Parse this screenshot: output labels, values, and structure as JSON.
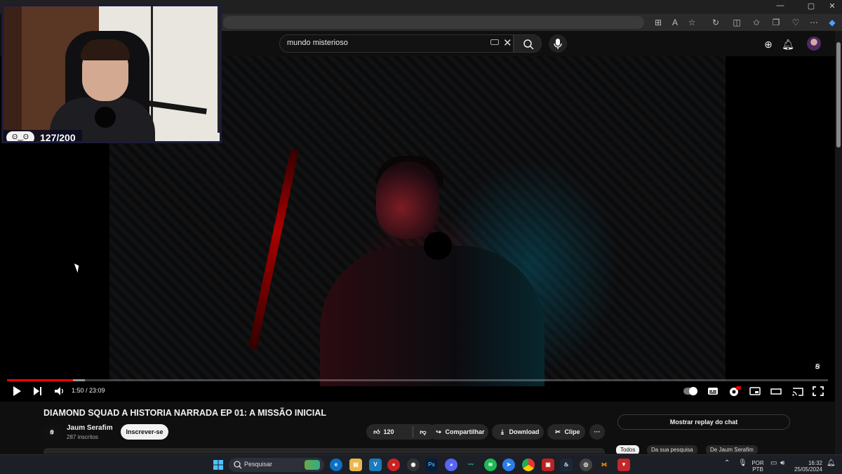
{
  "window": {
    "controls": [
      "—",
      "▢",
      "✕"
    ]
  },
  "browser_toolbar": {
    "icons": [
      "grid-icon",
      "read-aloud-icon",
      "favorite-star-icon",
      "refresh-icon",
      "split-screen-icon",
      "favorites-icon",
      "collections-icon",
      "heart-icon",
      "settings-icon",
      "copilot-icon"
    ]
  },
  "youtube": {
    "search": {
      "query": "mundo misterioso"
    },
    "header_icons": [
      "create-icon",
      "notifications-icon"
    ]
  },
  "webcam": {
    "counter_badge": "ʘ‿ʘ",
    "counter": "127/200"
  },
  "player": {
    "progress": {
      "played_fraction": 0.08,
      "buffered_fraction": 0.095
    },
    "time_display": "1:50 / 23:09",
    "watermark": "ꞩ"
  },
  "video": {
    "title": "DIAMOND SQUAD A HISTORIA NARRADA EP 01: A MISSÃO INICIAL",
    "channel": {
      "name": "Jaum Serafim",
      "subscribers": "287 inscritos",
      "avatar_text": "ꞩ"
    },
    "subscribe_label": "Inscrever-se",
    "likes": "120",
    "share_label": "Compartilhar",
    "download_label": "Download",
    "clip_label": "Clipe",
    "more_label": "···"
  },
  "chat": {
    "replay_label": "Mostrar replay do chat"
  },
  "chips": [
    "Todos",
    "Da sua pesquisa",
    "De Jaum Serafim"
  ],
  "taskbar": {
    "search_placeholder": "Pesquisar",
    "language": "POR",
    "layout": "PTB",
    "time": "16:32",
    "date": "25/05/2024"
  },
  "colors": {
    "accent_red": "#ff0000",
    "background": "#0f0f0f",
    "taskbar": "#1c1f26"
  }
}
